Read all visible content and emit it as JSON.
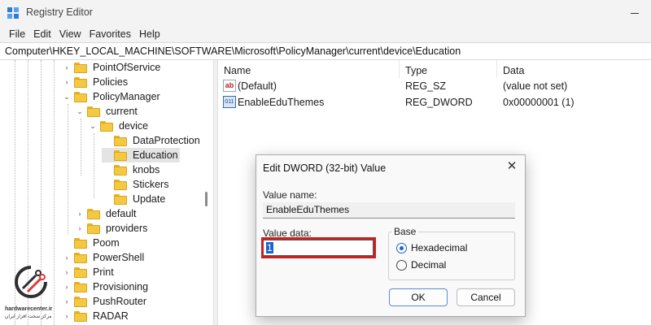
{
  "window": {
    "title": "Registry Editor"
  },
  "menu": [
    "File",
    "Edit",
    "View",
    "Favorites",
    "Help"
  ],
  "address": "Computer\\HKEY_LOCAL_MACHINE\\SOFTWARE\\Microsoft\\PolicyManager\\current\\device\\Education",
  "tree": [
    {
      "label": "PointOfService",
      "expandable": true,
      "selected": false
    },
    {
      "label": "Policies",
      "expandable": true,
      "selected": false
    },
    {
      "label": "PolicyManager",
      "expandable": true,
      "expanded": true,
      "selected": false
    },
    {
      "label": "current",
      "expandable": true,
      "expanded": true,
      "selected": false
    },
    {
      "label": "device",
      "expandable": true,
      "expanded": true,
      "selected": false
    },
    {
      "label": "DataProtection",
      "expandable": false,
      "selected": false
    },
    {
      "label": "Education",
      "expandable": false,
      "selected": true
    },
    {
      "label": "knobs",
      "expandable": false,
      "selected": false
    },
    {
      "label": "Stickers",
      "expandable": false,
      "selected": false
    },
    {
      "label": "Update",
      "expandable": false,
      "selected": false
    },
    {
      "label": "default",
      "expandable": true,
      "selected": false
    },
    {
      "label": "providers",
      "expandable": true,
      "selected": false
    },
    {
      "label": "Poom",
      "expandable": false,
      "selected": false
    },
    {
      "label": "PowerShell",
      "expandable": true,
      "selected": false
    },
    {
      "label": "Print",
      "expandable": true,
      "selected": false
    },
    {
      "label": "Provisioning",
      "expandable": true,
      "selected": false
    },
    {
      "label": "PushRouter",
      "expandable": true,
      "selected": false
    },
    {
      "label": "RADAR",
      "expandable": true,
      "selected": false
    }
  ],
  "columns": {
    "name": "Name",
    "type": "Type",
    "data": "Data"
  },
  "values": [
    {
      "icon": "string-value-icon",
      "name": "(Default)",
      "type": "REG_SZ",
      "data": "(value not set)"
    },
    {
      "icon": "binary-value-icon",
      "name": "EnableEduThemes",
      "type": "REG_DWORD",
      "data": "0x00000001 (1)"
    }
  ],
  "dialog": {
    "title": "Edit DWORD (32-bit) Value",
    "value_name_label": "Value name:",
    "value_name": "EnableEduThemes",
    "value_data_label": "Value data:",
    "value_data": "1",
    "base_label": "Base",
    "radio_hex": "Hexadecimal",
    "radio_dec": "Decimal",
    "base_selected": "Hexadecimal",
    "ok_label": "OK",
    "cancel_label": "Cancel"
  },
  "watermark": {
    "text": "hardwarecenter.ir",
    "subtext": "مرکز سخت افزار ایران"
  },
  "colors": {
    "highlight": "#c8201f",
    "selection": "#1c63c7",
    "folder": "#f5c842"
  }
}
